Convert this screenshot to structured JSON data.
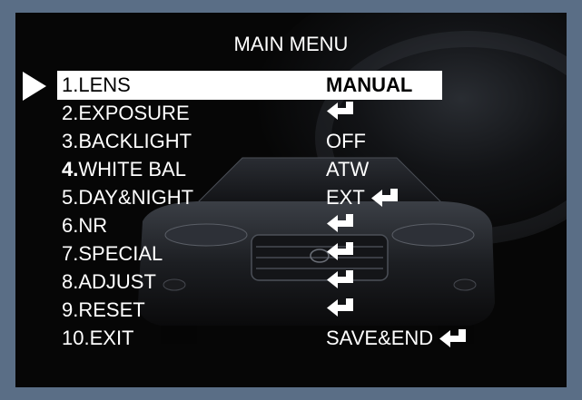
{
  "title": "MAIN MENU",
  "items": [
    {
      "num": "1.",
      "label": "LENS",
      "value": "MANUAL",
      "enter": false,
      "selected": true,
      "bold_num": false
    },
    {
      "num": "2.",
      "label": "EXPOSURE",
      "value": "",
      "enter": true,
      "selected": false,
      "bold_num": false
    },
    {
      "num": "3.",
      "label": "BACKLIGHT",
      "value": "OFF",
      "enter": false,
      "selected": false,
      "bold_num": false
    },
    {
      "num": "4.",
      "label": "WHITE BAL",
      "value": "ATW",
      "enter": false,
      "selected": false,
      "bold_num": true
    },
    {
      "num": "5.",
      "label": "DAY&NIGHT",
      "value": "EXT",
      "enter": true,
      "selected": false,
      "bold_num": false
    },
    {
      "num": "6.",
      "label": "NR",
      "value": "",
      "enter": true,
      "selected": false,
      "bold_num": false
    },
    {
      "num": "7.",
      "label": "SPECIAL",
      "value": "",
      "enter": true,
      "selected": false,
      "bold_num": false
    },
    {
      "num": "8.",
      "label": "ADJUST",
      "value": "",
      "enter": true,
      "selected": false,
      "bold_num": false
    },
    {
      "num": "9.",
      "label": "RESET",
      "value": "",
      "enter": true,
      "selected": false,
      "bold_num": false
    },
    {
      "num": "10.",
      "label": "EXIT",
      "value": "SAVE&END",
      "enter": true,
      "selected": false,
      "bold_num": false
    }
  ],
  "icons": {
    "pointer": "triangle-pointer-icon",
    "enter": "enter-arrow-icon"
  },
  "colors": {
    "border": "#5a6e86",
    "background": "#060606",
    "text": "#ffffff",
    "highlight": "#ffffff"
  }
}
